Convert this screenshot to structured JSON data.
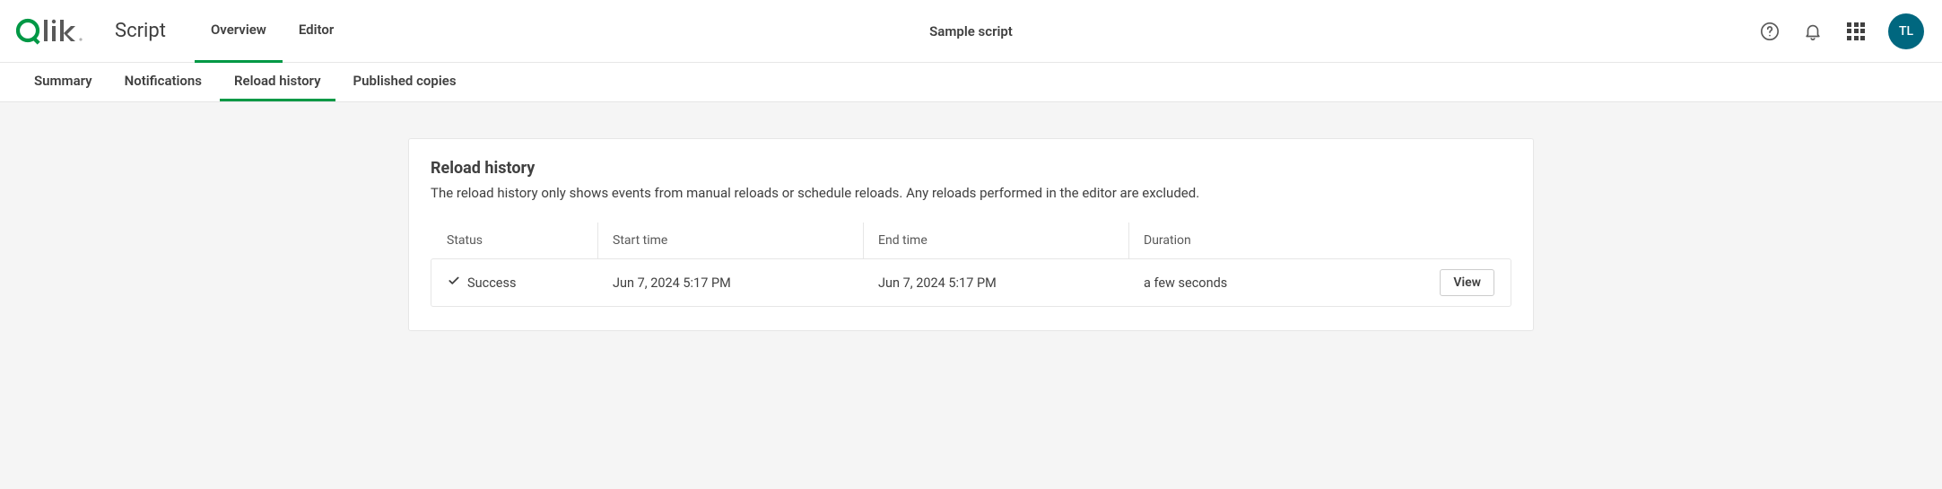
{
  "brand": {
    "product": "Script"
  },
  "primary_tabs": {
    "overview": "Overview",
    "editor": "Editor",
    "active": "overview"
  },
  "title": "Sample script",
  "user": {
    "initials": "TL"
  },
  "secondary_tabs": {
    "summary": "Summary",
    "notifications": "Notifications",
    "reload_history": "Reload history",
    "published_copies": "Published copies",
    "active": "reload_history"
  },
  "panel": {
    "heading": "Reload history",
    "description": "The reload history only shows events from manual reloads or schedule reloads. Any reloads performed in the editor are excluded."
  },
  "columns": {
    "status": "Status",
    "start_time": "Start time",
    "end_time": "End time",
    "duration": "Duration"
  },
  "row": {
    "status": "Success",
    "start_time": "Jun 7, 2024 5:17 PM",
    "end_time": "Jun 7, 2024 5:17 PM",
    "duration": "a few seconds",
    "action": "View"
  },
  "colors": {
    "accent": "#009845",
    "avatar_bg": "#00677f"
  }
}
